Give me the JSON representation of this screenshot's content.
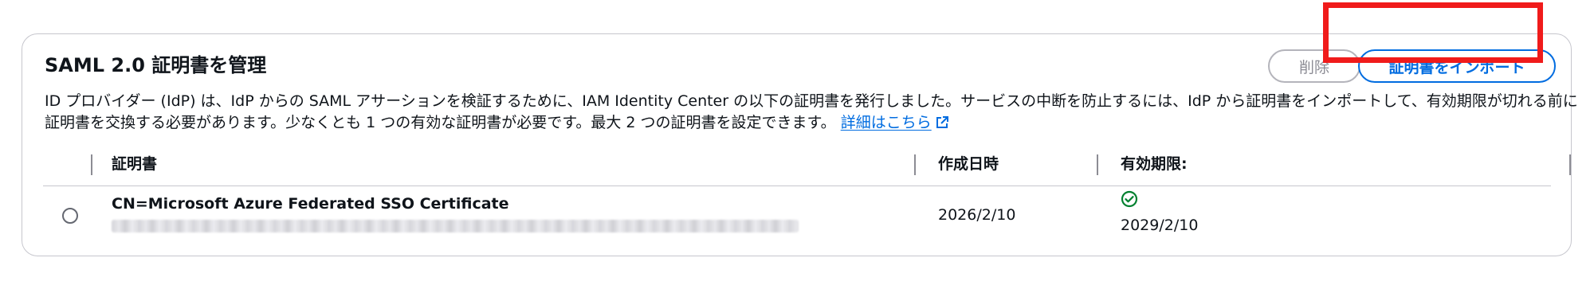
{
  "panel": {
    "title": "SAML 2.0 証明書を管理",
    "description": "ID プロバイダー (IdP) は、IdP からの SAML アサーションを検証するために、IAM Identity Center の以下の証明書を発行しました。サービスの中断を防止するには、IdP から証明書をインポートして、有効期限が切れる前に証明書を交換する必要があります。少なくとも 1 つの有効な証明書が必要です。最大 2 つの証明書を設定できます。",
    "learn_more_link": "詳細はこちら",
    "external_link_icon": "external-link-icon"
  },
  "actions": {
    "delete_label": "削除",
    "import_label": "証明書をインポート"
  },
  "table": {
    "columns": [
      "証明書",
      "作成日時",
      "有効期限:"
    ],
    "rows": [
      {
        "certificate": "CN=Microsoft Azure Federated SSO Certificate",
        "created": "2026/2/10",
        "status_icon": "check-circle-icon",
        "expires": "2029/2/10"
      }
    ]
  },
  "colors": {
    "accent": "#006ce0",
    "highlight": "#f01b1b",
    "success": "#00802f"
  }
}
